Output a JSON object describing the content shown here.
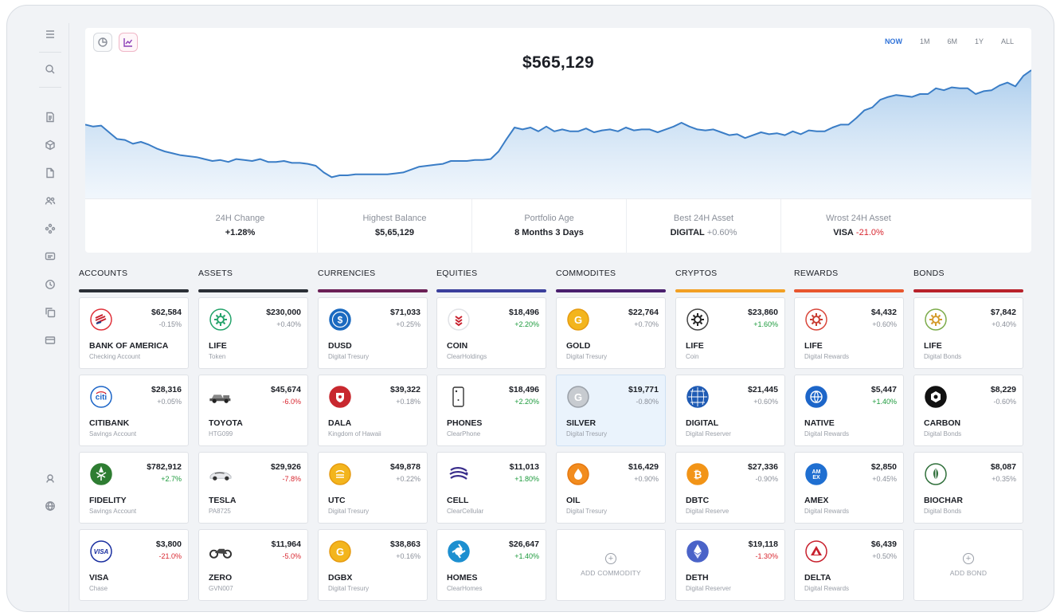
{
  "sidebar": {
    "items": [
      "menu-icon",
      "search-icon",
      "document-icon",
      "cube-icon",
      "file-icon",
      "users-icon",
      "network-icon",
      "message-icon",
      "clock-icon",
      "copy-icon",
      "card-icon",
      "support-icon",
      "globe-icon"
    ]
  },
  "header": {
    "balance": "$565,129",
    "ranges": [
      "NOW",
      "1M",
      "6M",
      "1Y",
      "ALL"
    ],
    "active_range": "NOW"
  },
  "chart_data": {
    "type": "area",
    "x": [
      0,
      1,
      2,
      3,
      4,
      5,
      6,
      7,
      8,
      9,
      10,
      11,
      12,
      13,
      14,
      15,
      16,
      17,
      18,
      19,
      20,
      21,
      22,
      23,
      24,
      25,
      26,
      27,
      28,
      29,
      30,
      31,
      32,
      33,
      34,
      35,
      36,
      37,
      38,
      39,
      40,
      41,
      42,
      43,
      44,
      45,
      46,
      47,
      48,
      49,
      50,
      51,
      52,
      53,
      54,
      55,
      56,
      57,
      58,
      59,
      60,
      61,
      62,
      63,
      64,
      65,
      66,
      67,
      68,
      69,
      70,
      71,
      72,
      73,
      74,
      75,
      76,
      77,
      78,
      79,
      80,
      81,
      82,
      83,
      84,
      85,
      86,
      87,
      88,
      89,
      90,
      91,
      92,
      93,
      94,
      95,
      96,
      97,
      98,
      99,
      100,
      101,
      102,
      103,
      104,
      105,
      106,
      107,
      108,
      109,
      110,
      111,
      112,
      113,
      114,
      115,
      116,
      117,
      118,
      119
    ],
    "values": [
      448,
      446,
      447,
      440,
      433,
      432,
      428,
      430,
      427,
      423,
      420,
      418,
      416,
      415,
      414,
      412,
      410,
      411,
      409,
      412,
      411,
      410,
      412,
      409,
      409,
      410,
      408,
      408,
      407,
      405,
      398,
      393,
      395,
      395,
      396,
      396,
      396,
      396,
      396,
      397,
      398,
      401,
      404,
      405,
      406,
      407,
      410,
      410,
      410,
      411,
      411,
      412,
      420,
      433,
      445,
      443,
      445,
      441,
      446,
      441,
      443,
      441,
      441,
      444,
      440,
      442,
      443,
      441,
      445,
      442,
      443,
      443,
      440,
      443,
      446,
      450,
      446,
      443,
      442,
      443,
      440,
      437,
      438,
      434,
      437,
      440,
      438,
      439,
      437,
      441,
      438,
      442,
      441,
      441,
      445,
      448,
      448,
      455,
      463,
      466,
      474,
      477,
      479,
      478,
      477,
      480,
      480,
      486,
      484,
      487,
      486,
      486,
      480,
      483,
      484,
      489,
      492,
      488,
      499,
      505
    ],
    "ylim": [
      370,
      520
    ],
    "xlabel": "",
    "ylabel": ""
  },
  "stats": [
    {
      "label": "24H Change",
      "value": "+1.28%",
      "suffix": "",
      "suffix_class": ""
    },
    {
      "label": "Highest Balance",
      "value": "$5,65,129",
      "suffix": "",
      "suffix_class": ""
    },
    {
      "label": "Portfolio Age",
      "value": "8 Months 3 Days",
      "suffix": "",
      "suffix_class": ""
    },
    {
      "label": "Best 24H Asset",
      "value": "DIGITAL",
      "suffix": "+0.60%",
      "suffix_class": "pos"
    },
    {
      "label": "Wrost 24H Asset",
      "value": "VISA",
      "suffix": "-21.0%",
      "suffix_class": "neg"
    }
  ],
  "categories": [
    {
      "title": "ACCOUNTS",
      "color": "#2b2f36",
      "cards": [
        {
          "icon": "bank-of-america-icon",
          "value": "$62,584",
          "change": "-0.15%",
          "trend": "flat",
          "name": "BANK OF AMERICA",
          "sub": "Checking Account"
        },
        {
          "icon": "citibank-icon",
          "value": "$28,316",
          "change": "+0.05%",
          "trend": "flat",
          "name": "CITIBANK",
          "sub": "Savings Account"
        },
        {
          "icon": "fidelity-icon",
          "value": "$782,912",
          "change": "+2.7%",
          "trend": "pos",
          "name": "FIDELITY",
          "sub": "Savings Account"
        },
        {
          "icon": "visa-icon",
          "value": "$3,800",
          "change": "-21.0%",
          "trend": "neg",
          "name": "VISA",
          "sub": "Chase"
        }
      ]
    },
    {
      "title": "ASSETS",
      "color": "#2b2f36",
      "cards": [
        {
          "icon": "life-token-icon",
          "value": "$230,000",
          "change": "+0.40%",
          "trend": "flat",
          "name": "LIFE",
          "sub": "Token"
        },
        {
          "icon": "pickup-truck-icon",
          "value": "$45,674",
          "change": "-6.0%",
          "trend": "neg",
          "name": "TOYOTA",
          "sub": "HTG099"
        },
        {
          "icon": "sedan-car-icon",
          "value": "$29,926",
          "change": "-7.8%",
          "trend": "neg",
          "name": "TESLA",
          "sub": "PA8725"
        },
        {
          "icon": "motorcycle-icon",
          "value": "$11,964",
          "change": "-5.0%",
          "trend": "neg",
          "name": "ZERO",
          "sub": "GVN007"
        }
      ]
    },
    {
      "title": "CURRENCIES",
      "color": "#6b1f56",
      "cards": [
        {
          "icon": "dollar-coin-icon",
          "value": "$71,033",
          "change": "+0.25%",
          "trend": "flat",
          "name": "DUSD",
          "sub": "Digital Tresury"
        },
        {
          "icon": "shield-crest-icon",
          "value": "$39,322",
          "change": "+0.18%",
          "trend": "flat",
          "name": "DALA",
          "sub": "Kingdom of Hawaii"
        },
        {
          "icon": "utc-coin-icon",
          "value": "$49,878",
          "change": "+0.22%",
          "trend": "flat",
          "name": "UTC",
          "sub": "Digital Tresury"
        },
        {
          "icon": "gold-g-coin-icon",
          "value": "$38,863",
          "change": "+0.16%",
          "trend": "flat",
          "name": "DGBX",
          "sub": "Digital Tresury"
        }
      ]
    },
    {
      "title": "EQUITIES",
      "color": "#3b3f9c",
      "cards": [
        {
          "icon": "coin-logo-icon",
          "value": "$18,496",
          "change": "+2.20%",
          "trend": "pos",
          "name": "COIN",
          "sub": "ClearHoldings"
        },
        {
          "icon": "phone-icon",
          "value": "$18,496",
          "change": "+2.20%",
          "trend": "pos",
          "name": "PHONES",
          "sub": "ClearPhone"
        },
        {
          "icon": "cell-logo-icon",
          "value": "$11,013",
          "change": "+1.80%",
          "trend": "pos",
          "name": "CELL",
          "sub": "ClearCellular"
        },
        {
          "icon": "homes-logo-icon",
          "value": "$26,647",
          "change": "+1.40%",
          "trend": "pos",
          "name": "HOMES",
          "sub": "ClearHomes"
        }
      ]
    },
    {
      "title": "COMMODITES",
      "color": "#4a1f6e",
      "add_label": "ADD COMMODITY",
      "cards": [
        {
          "icon": "gold-coin-icon",
          "value": "$22,764",
          "change": "+0.70%",
          "trend": "flat",
          "name": "GOLD",
          "sub": "Digital Tresury"
        },
        {
          "icon": "silver-coin-icon",
          "value": "$19,771",
          "change": "-0.80%",
          "trend": "flat",
          "name": "SILVER",
          "sub": "Digital Tresury"
        },
        {
          "icon": "oil-drop-icon",
          "value": "$16,429",
          "change": "+0.90%",
          "trend": "flat",
          "name": "OIL",
          "sub": "Digital Tresury"
        }
      ]
    },
    {
      "title": "CRYPTOS",
      "color": "#f2a024",
      "cards": [
        {
          "icon": "life-coin-icon",
          "value": "$23,860",
          "change": "+1.60%",
          "trend": "pos",
          "name": "LIFE",
          "sub": "Coin"
        },
        {
          "icon": "digital-globe-icon",
          "value": "$21,445",
          "change": "+0.60%",
          "trend": "flat",
          "name": "DIGITAL",
          "sub": "Digital Reserver"
        },
        {
          "icon": "bitcoin-icon",
          "value": "$27,336",
          "change": "-0.90%",
          "trend": "flat",
          "name": "DBTC",
          "sub": "Digital Reserve"
        },
        {
          "icon": "ethereum-icon",
          "value": "$19,118",
          "change": "-1.30%",
          "trend": "neg",
          "name": "DETH",
          "sub": "Digital Reserver"
        }
      ]
    },
    {
      "title": "REWARDS",
      "color": "#e8562e",
      "cards": [
        {
          "icon": "life-rewards-icon",
          "value": "$4,432",
          "change": "+0.60%",
          "trend": "flat",
          "name": "LIFE",
          "sub": "Digital Rewards"
        },
        {
          "icon": "native-globe-icon",
          "value": "$5,447",
          "change": "+1.40%",
          "trend": "pos",
          "name": "NATIVE",
          "sub": "Digital Rewards"
        },
        {
          "icon": "amex-icon",
          "value": "$2,850",
          "change": "+0.45%",
          "trend": "flat",
          "name": "AMEX",
          "sub": "Digital Rewards"
        },
        {
          "icon": "delta-icon",
          "value": "$6,439",
          "change": "+0.50%",
          "trend": "flat",
          "name": "DELTA",
          "sub": "Digital Rewards"
        }
      ]
    },
    {
      "title": "BONDS",
      "color": "#b8222b",
      "add_label": "ADD BOND",
      "cards": [
        {
          "icon": "life-bonds-icon",
          "value": "$7,842",
          "change": "+0.40%",
          "trend": "flat",
          "name": "LIFE",
          "sub": "Digital Bonds"
        },
        {
          "icon": "carbon-icon",
          "value": "$8,229",
          "change": "-0.60%",
          "trend": "flat",
          "name": "CARBON",
          "sub": "Digital Bonds"
        },
        {
          "icon": "biochar-icon",
          "value": "$8,087",
          "change": "+0.35%",
          "trend": "flat",
          "name": "BIOCHAR",
          "sub": "Digital Bonds"
        }
      ]
    }
  ]
}
